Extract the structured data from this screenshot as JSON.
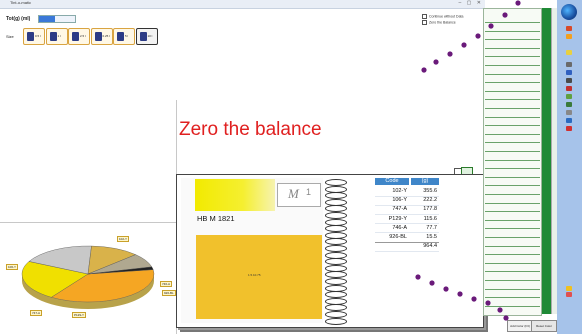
{
  "window": {
    "title": "Tint-o-matic",
    "controls": "– ▢ ✕"
  },
  "toolbar": {
    "total_label": "Tot(g) (ml)",
    "total_progress": 0.45,
    "size_label": "Size",
    "sizes": [
      {
        "label": "0.5 l",
        "selected": false
      },
      {
        "label": "1 l",
        "selected": false
      },
      {
        "label": "2.5 l",
        "selected": false
      },
      {
        "label": "0.25 l",
        "selected": false
      },
      {
        "label": "5 l",
        "selected": false
      },
      {
        "label": "10 l",
        "selected": true
      }
    ]
  },
  "options": {
    "check1": "Continue without Data",
    "check2": "Zero the Balance"
  },
  "headline": "Zero the balance",
  "book": {
    "color_name": "HB M 1821",
    "logo": {
      "m": "M",
      "n": "1"
    },
    "swatch_tag": "1.5.10.75",
    "formula": {
      "headers": [
        "Code",
        "(g)"
      ],
      "rows": [
        {
          "code": "102-Y",
          "grams": "355.6"
        },
        {
          "code": "106-Y",
          "grams": "222.2"
        },
        {
          "code": "747-A",
          "grams": "177.8"
        },
        {
          "code": "P129-Y",
          "grams": "115.6"
        },
        {
          "code": "746-A",
          "grams": "77.7"
        },
        {
          "code": "926-BL",
          "grams": "15.5"
        },
        {
          "code": "",
          "grams": "964.4"
        }
      ]
    }
  },
  "pie": {
    "slices": [
      {
        "label": "102-Y",
        "value": 355.6,
        "color": "#f5a623"
      },
      {
        "label": "106-Y",
        "value": 222.2,
        "color": "#f0e000"
      },
      {
        "label": "747-A",
        "value": 177.8,
        "color": "#c8c8c8"
      },
      {
        "label": "P129-Y",
        "value": 115.6,
        "color": "#d9b24a"
      },
      {
        "label": "746-A",
        "value": 77.7,
        "color": "#b0a890"
      },
      {
        "label": "926-BL",
        "value": 15.5,
        "color": "#202020"
      }
    ]
  },
  "list_panel": {
    "rows": 34
  },
  "bottom_tabs": [
    "Add Color (F3)",
    "Reset Color"
  ],
  "colors": {
    "accent": "#3f86c9",
    "headline": "#e02020",
    "scrollbar": "#1f8a36",
    "sidebar": "#a6c3ea"
  }
}
